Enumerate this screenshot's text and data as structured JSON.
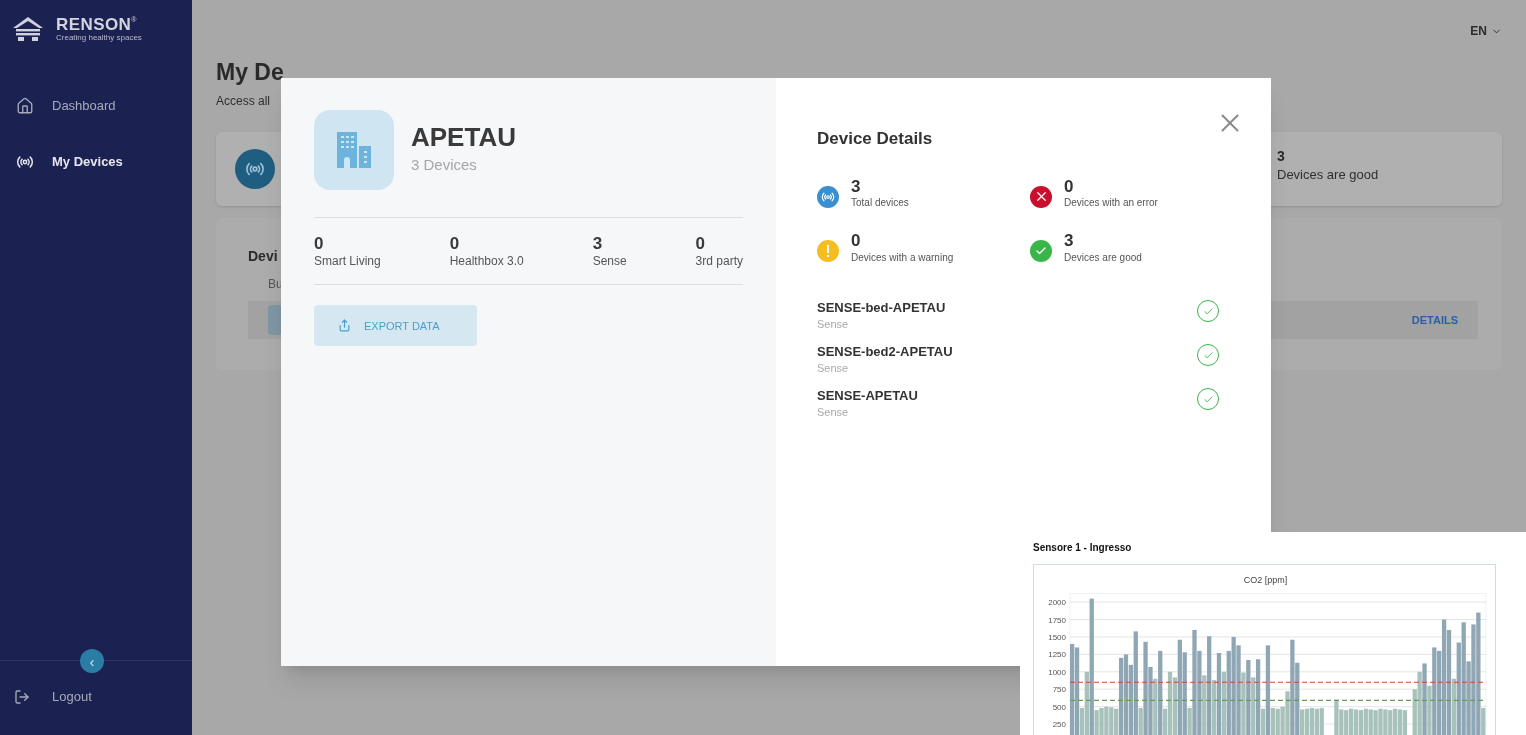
{
  "sidebar": {
    "logo": {
      "name": "RENSON",
      "mark": "®",
      "tagline": "Creating healthy spaces"
    },
    "items": [
      {
        "label": "Dashboard",
        "kind": "home",
        "selected": false
      },
      {
        "label": "My Devices",
        "kind": "signal",
        "selected": true
      }
    ],
    "collapse": {
      "label": "‹"
    },
    "footer": {
      "label": "Logout"
    }
  },
  "topbar": {
    "language": "EN"
  },
  "page": {
    "title": "My De",
    "subtitle": "Access all",
    "summary": {
      "value": "3",
      "label": "Devices are good"
    },
    "list_card": {
      "title": "Devi",
      "subtitle": "Bu",
      "action": "DETAILS"
    }
  },
  "modal": {
    "site": {
      "name": "APETAU",
      "count": "3 Devices"
    },
    "stats": [
      {
        "value": "0",
        "label": "Smart Living"
      },
      {
        "value": "0",
        "label": "Healthbox 3.0"
      },
      {
        "value": "3",
        "label": "Sense"
      },
      {
        "value": "0",
        "label": "3rd party"
      }
    ],
    "export": "EXPORT DATA",
    "details_title": "Device Details",
    "details": [
      {
        "kind": "total",
        "value": "3",
        "label": "Total devices"
      },
      {
        "kind": "error",
        "value": "0",
        "label": "Devices with an error"
      },
      {
        "kind": "warning",
        "value": "0",
        "label": "Devices with a warning"
      },
      {
        "kind": "good",
        "value": "3",
        "label": "Devices are good"
      }
    ],
    "devices": [
      {
        "name": "SENSE-bed-APETAU",
        "type": "Sense",
        "kind": "good"
      },
      {
        "name": "SENSE-bed2-APETAU",
        "type": "Sense",
        "kind": "good"
      },
      {
        "name": "SENSE-APETAU",
        "type": "Sense",
        "kind": "good"
      }
    ]
  },
  "inset": {
    "title": "Sensore 1 - Ingresso",
    "chart_data": {
      "type": "bar",
      "title": "CO2 [ppm]",
      "grid": true,
      "ylim": [
        0,
        2125
      ],
      "yticks": [
        250,
        500,
        750,
        1000,
        1250,
        1500,
        1750,
        2000
      ],
      "values": [
        1400,
        1350,
        480,
        1000,
        2050,
        450,
        480,
        500,
        490,
        470,
        1200,
        1250,
        1100,
        1580,
        480,
        1430,
        1070,
        900,
        1300,
        470,
        1000,
        920,
        1460,
        1280,
        480,
        1600,
        1300,
        950,
        1510,
        880,
        1270,
        1000,
        1300,
        1500,
        1380,
        990,
        1170,
        920,
        1180,
        470,
        1380,
        480,
        470,
        500,
        720,
        1460,
        1130,
        460,
        470,
        480,
        470,
        480,
        null,
        null,
        600,
        460,
        450,
        470,
        460,
        450,
        470,
        460,
        450,
        470,
        460,
        450,
        470,
        460,
        450,
        null,
        750,
        1000,
        1120,
        800,
        1350,
        1300,
        1750,
        1600,
        900,
        1420,
        1710,
        1150,
        1680,
        1850,
        480
      ],
      "ref_lines": [
        {
          "axis": "y",
          "value": 850,
          "color": "#c0502a"
        },
        {
          "axis": "y",
          "value": 590,
          "color": "#6a9a5a"
        }
      ]
    }
  }
}
